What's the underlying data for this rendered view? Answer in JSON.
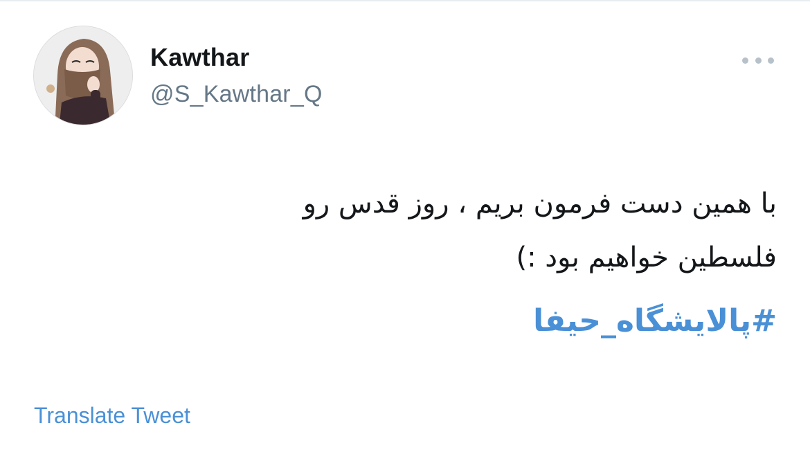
{
  "tweet": {
    "author": {
      "display_name": "Kawthar",
      "handle": "@S_Kawthar_Q",
      "avatar_icon": "avatar-hijab-illustration"
    },
    "more_icon": "more-horizontal-icon",
    "text_lines": [
      "با همین دست فرمون بریم ، روز قدس رو",
      "فلسطین خواهیم بود :)"
    ],
    "hashtag": "#پالایشگاه_حیفا",
    "translate_label": "Translate Tweet"
  },
  "colors": {
    "text_primary": "#14171a",
    "text_secondary": "#657786",
    "link": "#4a90d6",
    "more_dots": "#b7c1c9",
    "border": "#e6ecf0"
  }
}
